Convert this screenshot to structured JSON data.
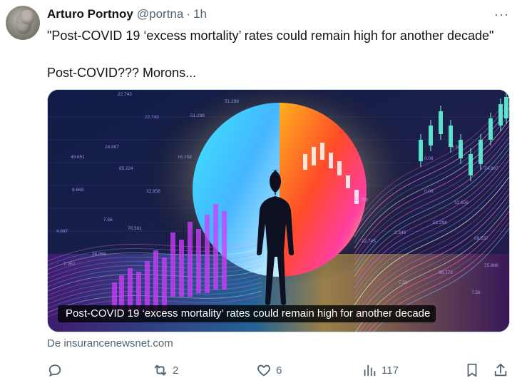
{
  "tweet": {
    "author_name": "Arturo Portnoy",
    "handle": "@portna",
    "separator": "·",
    "time": "1h",
    "more_label": "···",
    "text_line1": "\"Post-COVID 19 ‘excess mortality’ rates could remain high for another decade\"",
    "text_line2": "Post-COVID??? Morons..."
  },
  "card": {
    "caption": "Post-COVID 19 ‘excess mortality’ rates could remain high for another decade",
    "source": "De insurancenewsnet.com",
    "image_numbers": [
      "22.743",
      "51.298",
      "22.743",
      "24.897",
      "49.651",
      "16.158",
      "85.224",
      "8.668",
      "32.858",
      "7.58",
      "78.561",
      "4.897",
      "36.886",
      "7.352",
      "49.651",
      "51.298",
      "11.798",
      "0.08",
      "9.34",
      "24.897",
      "0.08",
      "32.658",
      "51.298",
      "2.345",
      "22.745",
      "69.537",
      "98.773",
      "25.886",
      "7.58",
      "7.58"
    ]
  },
  "actions": {
    "reply_count": "",
    "retweet_count": "2",
    "like_count": "6",
    "views_count": "117"
  },
  "colors": {
    "text_primary": "#0f1419",
    "text_secondary": "#536471",
    "caption_bg": "#000000"
  },
  "icons": [
    "more-icon",
    "reply-icon",
    "retweet-icon",
    "like-icon",
    "views-icon",
    "bookmark-icon",
    "share-icon"
  ]
}
